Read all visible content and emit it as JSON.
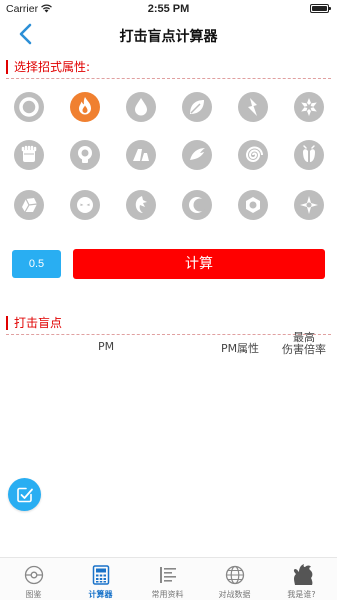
{
  "status_bar": {
    "carrier": "Carrier",
    "time": "2:55 PM"
  },
  "nav": {
    "title": "打击盲点计算器",
    "back_icon": "chevron-left-icon"
  },
  "type_section": {
    "label": "选择招式属性:",
    "types": [
      {
        "name": "normal-type-icon",
        "selected": false
      },
      {
        "name": "fire-type-icon",
        "selected": true
      },
      {
        "name": "water-type-icon",
        "selected": false
      },
      {
        "name": "grass-type-icon",
        "selected": false
      },
      {
        "name": "electric-type-icon",
        "selected": false
      },
      {
        "name": "ice-type-icon",
        "selected": false
      },
      {
        "name": "fighting-type-icon",
        "selected": false
      },
      {
        "name": "poison-type-icon",
        "selected": false
      },
      {
        "name": "ground-type-icon",
        "selected": false
      },
      {
        "name": "flying-type-icon",
        "selected": false
      },
      {
        "name": "psychic-type-icon",
        "selected": false
      },
      {
        "name": "bug-type-icon",
        "selected": false
      },
      {
        "name": "rock-type-icon",
        "selected": false
      },
      {
        "name": "ghost-type-icon",
        "selected": false
      },
      {
        "name": "dragon-type-icon",
        "selected": false
      },
      {
        "name": "dark-type-icon",
        "selected": false
      },
      {
        "name": "steel-type-icon",
        "selected": false
      },
      {
        "name": "fairy-type-icon",
        "selected": false
      }
    ]
  },
  "controls": {
    "value": "0.5",
    "calculate_label": "计算"
  },
  "results": {
    "label": "打击盲点",
    "columns": {
      "pm": "PM",
      "pm_attr": "PM属性",
      "max_line1": "最高",
      "max_line2": "伤害倍率"
    }
  },
  "fab": {
    "icon": "edit-check-icon"
  },
  "tabs": [
    {
      "label": "图鉴",
      "icon": "pokeball-icon",
      "active": false
    },
    {
      "label": "计算器",
      "icon": "calculator-icon",
      "active": true
    },
    {
      "label": "常用资料",
      "icon": "list-icon",
      "active": false
    },
    {
      "label": "对战数据",
      "icon": "globe-icon",
      "active": false
    },
    {
      "label": "我是谁?",
      "icon": "pokemon-silhouette-icon",
      "active": false
    }
  ],
  "colors": {
    "accent_red": "#ff0000",
    "accent_blue": "#29aef2",
    "icon_gray": "#bdbdbd",
    "fire_orange": "#f08030",
    "active_tab": "#1a73c9"
  }
}
